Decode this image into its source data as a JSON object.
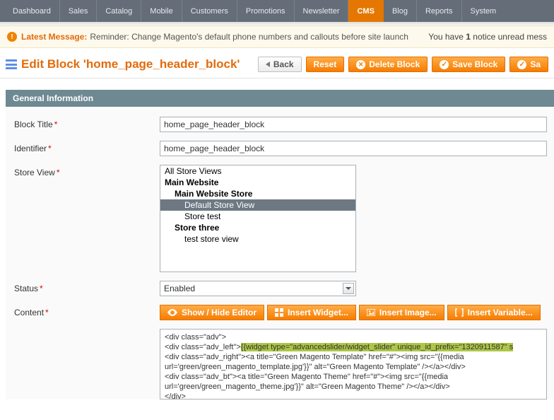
{
  "nav": {
    "items": [
      "Dashboard",
      "Sales",
      "Catalog",
      "Mobile",
      "Customers",
      "Promotions",
      "Newsletter",
      "CMS",
      "Blog",
      "Reports",
      "System"
    ],
    "active_index": 7
  },
  "notice": {
    "label": "Latest Message:",
    "text": "Reminder: Change Magento's default phone numbers and callouts before site launch",
    "right_prefix": "You have ",
    "right_count": "1",
    "right_suffix": " notice unread mess"
  },
  "page": {
    "title": "Edit Block 'home_page_header_block'"
  },
  "buttons": {
    "back": "Back",
    "reset": "Reset",
    "delete": "Delete Block",
    "save": "Save Block",
    "save_and": "Sa"
  },
  "section": {
    "title": "General Information"
  },
  "fields": {
    "block_title": {
      "label": "Block Title",
      "value": "home_page_header_block"
    },
    "identifier": {
      "label": "Identifier",
      "value": "home_page_header_block"
    },
    "store_view": {
      "label": "Store View",
      "options": [
        {
          "text": "All Store Views",
          "level": 0,
          "selected": false
        },
        {
          "text": "Main Website",
          "level": 1,
          "selected": false
        },
        {
          "text": "Main Website Store",
          "level": 2,
          "selected": false
        },
        {
          "text": "Default Store View",
          "level": 3,
          "selected": true
        },
        {
          "text": "Store test",
          "level": 3,
          "selected": false
        },
        {
          "text": "Store three",
          "level": 2,
          "selected": false
        },
        {
          "text": "test store view",
          "level": 3,
          "selected": false
        }
      ]
    },
    "status": {
      "label": "Status",
      "value": "Enabled"
    },
    "content": {
      "label": "Content",
      "toolbar": {
        "show_hide": "Show / Hide Editor",
        "insert_widget": "Insert Widget...",
        "insert_image": "Insert Image...",
        "insert_variable": "Insert Variable..."
      },
      "lines": [
        {
          "pre": "<div class=\"adv\">",
          "hl": "",
          "post": ""
        },
        {
          "pre": "<div class=\"adv_left\">",
          "hl": "{{widget type=\"advancedslider/widget_slider\" unique_id_prefix=\"1320911587\" s",
          "post": ""
        },
        {
          "pre": "<div class=\"adv_right\"><a title=\"Green Magento Template\" href=\"#\"><img src=\"{{media",
          "hl": "",
          "post": ""
        },
        {
          "pre": "url='green/green_magento_template.jpg'}}\" alt=\"Green Magento Template\" /></a></div>",
          "hl": "",
          "post": ""
        },
        {
          "pre": "<div class=\"adv_bt\"><a title=\"Green Magento Theme\" href=\"#\"><img src=\"{{media",
          "hl": "",
          "post": ""
        },
        {
          "pre": "url='green/green_magento_theme.jpg'}}\" alt=\"Green Magento Theme\" /></a></div>",
          "hl": "",
          "post": ""
        },
        {
          "pre": "</div>",
          "hl": "",
          "post": ""
        }
      ]
    }
  }
}
